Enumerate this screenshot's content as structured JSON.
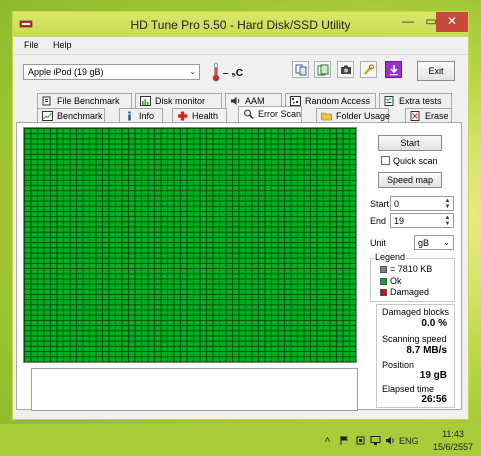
{
  "window": {
    "title": "HD Tune Pro 5.50 - Hard Disk/SSD Utility",
    "min_glyph": "—",
    "max_glyph": "▭",
    "close_glyph": "✕"
  },
  "menu": {
    "file": "File",
    "help": "Help"
  },
  "toolbar": {
    "drive": "Apple  iPod (19 gB)",
    "temperature": "– ₅C",
    "exit_label": "Exit"
  },
  "tabs": {
    "row1": [
      "File Benchmark",
      "Disk monitor",
      "AAM",
      "Random Access",
      "Extra tests"
    ],
    "row2": [
      "Benchmark",
      "Info",
      "Health",
      "Error Scan",
      "Folder Usage",
      "Erase"
    ],
    "active": "Error Scan"
  },
  "scan": {
    "start_button": "Start",
    "quick_scan_label": "Quick scan",
    "quick_scan_checked": false,
    "speed_map_button": "Speed map",
    "start_label": "Start",
    "start_value": "0",
    "end_label": "End",
    "end_value": "19",
    "unit_label": "Unit",
    "unit_value": "gB"
  },
  "legend": {
    "title": "Legend",
    "items": [
      {
        "label": "= 7810 KB",
        "color": "#7f7f7f"
      },
      {
        "label": "Ok",
        "color": "#00b020"
      },
      {
        "label": "Damaged",
        "color": "#e00000"
      }
    ]
  },
  "stats": {
    "damaged_label": "Damaged blocks",
    "damaged_value": "0.0 %",
    "speed_label": "Scanning speed",
    "speed_value": "8.7 MB/s",
    "position_label": "Position",
    "position_value": "19 gB",
    "elapsed_label": "Elapsed time",
    "elapsed_value": "26:56"
  },
  "taskbar": {
    "language": "ENG",
    "time": "11:43",
    "date": "15/6/2557"
  },
  "colors": {
    "ok_green": "#00b020",
    "grid_line": "#004d0a",
    "close_red": "#c74a3c",
    "accent_purple": "#9b2fd0"
  }
}
